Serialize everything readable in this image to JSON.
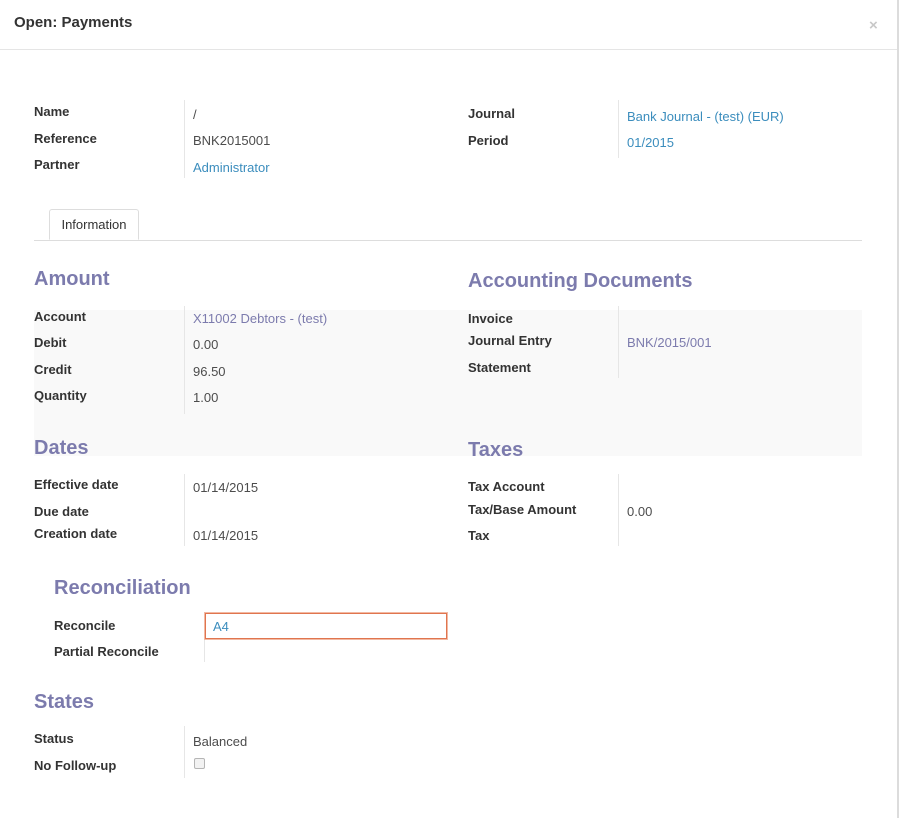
{
  "dialog": {
    "title": "Open: Payments",
    "close": "×"
  },
  "header": {
    "name_label": "Name",
    "name_value": "/",
    "reference_label": "Reference",
    "reference_value": "BNK2015001",
    "partner_label": "Partner",
    "partner_value": "Administrator",
    "journal_label": "Journal",
    "journal_value": "Bank Journal - (test) (EUR)",
    "period_label": "Period",
    "period_value": "01/2015"
  },
  "tabs": [
    {
      "label": "Information",
      "active": true
    }
  ],
  "amount": {
    "title": "Amount",
    "account_label": "Account",
    "account_value": "X11002 Debtors - (test)",
    "debit_label": "Debit",
    "debit_value": "0.00",
    "credit_label": "Credit",
    "credit_value": "96.50",
    "quantity_label": "Quantity",
    "quantity_value": "1.00"
  },
  "accounting_documents": {
    "title": "Accounting Documents",
    "invoice_label": "Invoice",
    "invoice_value": "",
    "journal_entry_label": "Journal Entry",
    "journal_entry_value": "BNK/2015/001",
    "statement_label": "Statement",
    "statement_value": ""
  },
  "dates": {
    "title": "Dates",
    "effective_label": "Effective date",
    "effective_value": "01/14/2015",
    "due_label": "Due date",
    "due_value": "",
    "creation_label": "Creation date",
    "creation_value": "01/14/2015"
  },
  "taxes": {
    "title": "Taxes",
    "tax_account_label": "Tax Account",
    "tax_account_value": "",
    "tax_base_label": "Tax/Base Amount",
    "tax_base_value": "0.00",
    "tax_label": "Tax",
    "tax_value": ""
  },
  "reconciliation": {
    "title": "Reconciliation",
    "reconcile_label": "Reconcile",
    "reconcile_value": "A4",
    "partial_label": "Partial Reconcile",
    "partial_value": ""
  },
  "states": {
    "title": "States",
    "status_label": "Status",
    "status_value": "Balanced",
    "followup_label": "No Follow-up",
    "followup_checked": false
  },
  "colors": {
    "section": "#7c7bad",
    "link": "#3b8dbd",
    "focus_border": "#e0754f"
  }
}
